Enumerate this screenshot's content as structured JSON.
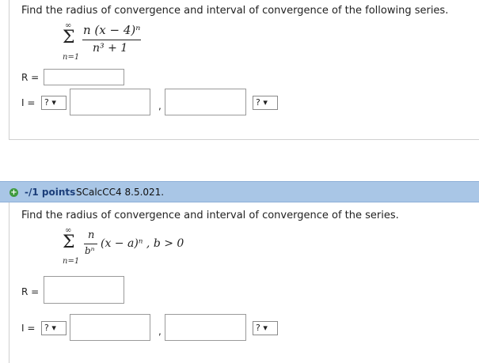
{
  "q1": {
    "prompt": "Find the radius of convergence and interval of convergence of the following series.",
    "series": {
      "sum_symbol": "Σ",
      "upper_limit": "∞",
      "lower_limit": "n=1",
      "numerator": "n (x − 4)ⁿ",
      "denominator": "n³ + 1"
    },
    "r_label": "R =",
    "i_label": "I =",
    "left_bracket_select": "? ▾",
    "comma": ",",
    "right_bracket_select": "? ▾"
  },
  "q2": {
    "points": "-/1 points",
    "code": "SCalcCC4 8.5.021.",
    "prompt": "Find the radius of convergence and interval of convergence of the series.",
    "series": {
      "sum_symbol": "Σ",
      "upper_limit": "∞",
      "lower_limit": "n=1",
      "numerator": "n",
      "denominator": "bⁿ",
      "tail": "(x − a)ⁿ , b > 0"
    },
    "r_label": "R =",
    "i_label": "I =",
    "left_bracket_select": "? ▾",
    "comma": ",",
    "right_bracket_select": "? ▾"
  },
  "colors": {
    "header_bg": "#a9c6e6",
    "points_text": "#1b3e7a",
    "plus_icon": "#3f9a3f"
  }
}
